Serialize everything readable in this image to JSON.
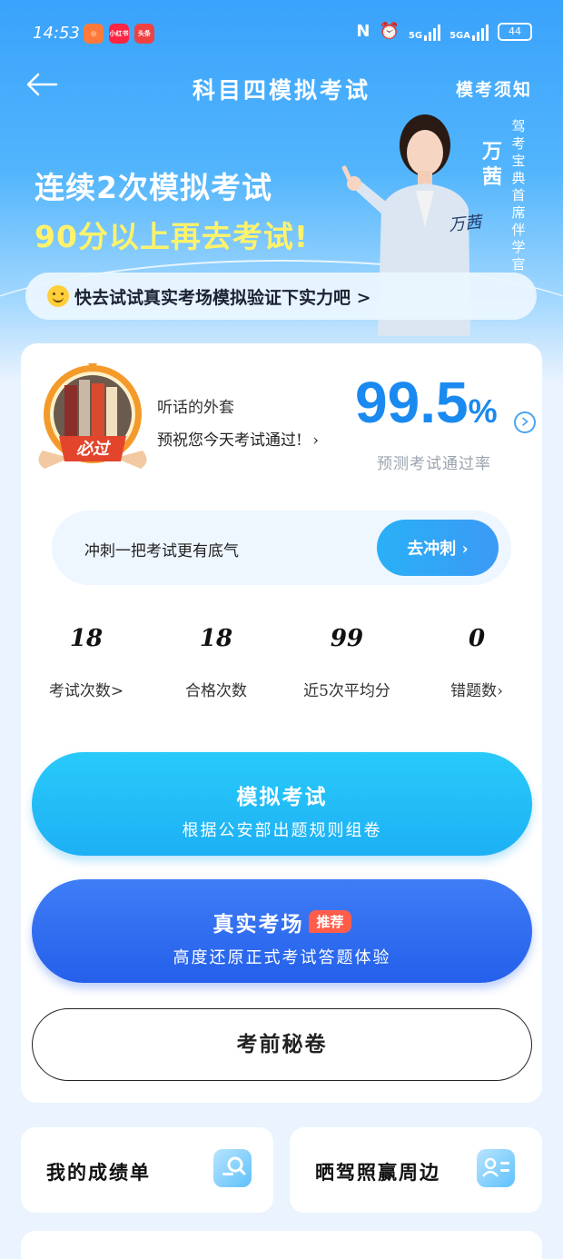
{
  "status_bar": {
    "time": "14:53",
    "apps": [
      "小红书",
      "头条"
    ],
    "network1": "5G",
    "network2": "5GA",
    "battery": "44"
  },
  "nav": {
    "title": "科目四模拟考试",
    "right_link": "模考须知"
  },
  "hero": {
    "line1": "连续2次模拟考试",
    "line2": "90分以上再去考试!",
    "coach_name": "万茜",
    "coach_title": "驾考宝典首席伴学官",
    "promo": "快去试试真实考场模拟验证下实力吧 >"
  },
  "profile": {
    "username": "听话的外套",
    "wish": "预祝您今天考试通过!",
    "badge_text": "必过"
  },
  "prediction": {
    "rate": "99.5",
    "unit": "%",
    "label": "预测考试通过率"
  },
  "sprint": {
    "text": "冲刺一把考试更有底气",
    "button": "去冲刺 ›"
  },
  "stats": [
    {
      "value": "18",
      "label": "考试次数>"
    },
    {
      "value": "18",
      "label": "合格次数"
    },
    {
      "value": "99",
      "label": "近5次平均分"
    },
    {
      "value": "0",
      "label": "错题数›"
    }
  ],
  "actions": {
    "simulate": {
      "title": "模拟考试",
      "subtitle": "根据公安部出题规则组卷"
    },
    "real": {
      "title": "真实考场",
      "tag": "推荐",
      "subtitle": "高度还原正式考试答题体验"
    },
    "secret": {
      "title": "考前秘卷"
    }
  },
  "shortcuts": [
    {
      "label": "我的成绩单",
      "icon": "report-search-icon"
    },
    {
      "label": "晒驾照赢周边",
      "icon": "id-card-icon"
    }
  ],
  "colors": {
    "primary": "#1a89f0",
    "simulate_btn": "#1db0f4",
    "real_btn": "#2460ea",
    "tag": "#ff5d4a",
    "hero_yellow": "#fff36b"
  }
}
